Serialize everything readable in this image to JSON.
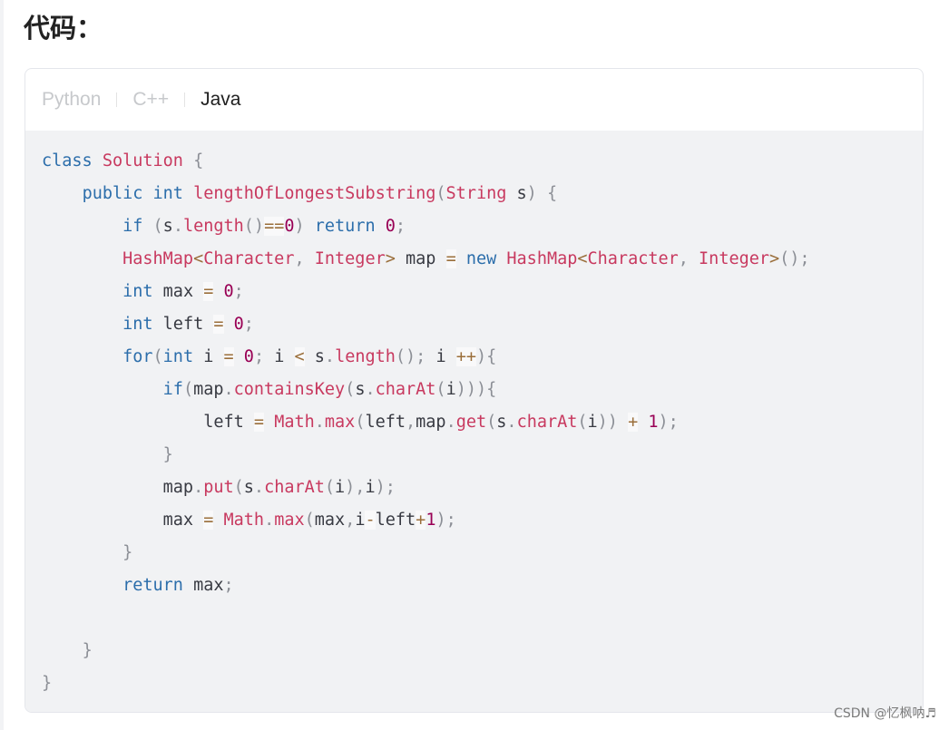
{
  "heading": "代码：",
  "tabs": [
    {
      "label": "Python",
      "active": false
    },
    {
      "label": "C++",
      "active": false
    },
    {
      "label": "Java",
      "active": true
    }
  ],
  "code_lines": [
    [
      [
        "kw",
        "class"
      ],
      [
        "id",
        " "
      ],
      [
        "ty",
        "Solution"
      ],
      [
        "id",
        " "
      ],
      [
        "pu",
        "{"
      ]
    ],
    [
      [
        "id",
        "    "
      ],
      [
        "kw",
        "public"
      ],
      [
        "id",
        " "
      ],
      [
        "kw",
        "int"
      ],
      [
        "id",
        " "
      ],
      [
        "fn",
        "lengthOfLongestSubstring"
      ],
      [
        "pu",
        "("
      ],
      [
        "ty",
        "String"
      ],
      [
        "id",
        " s"
      ],
      [
        "pu",
        ")"
      ],
      [
        "id",
        " "
      ],
      [
        "pu",
        "{"
      ]
    ],
    [
      [
        "id",
        "        "
      ],
      [
        "kw",
        "if"
      ],
      [
        "id",
        " "
      ],
      [
        "pu",
        "("
      ],
      [
        "id",
        "s"
      ],
      [
        "pu",
        "."
      ],
      [
        "fn",
        "length"
      ],
      [
        "pu",
        "()"
      ],
      [
        "op-hl",
        "=="
      ],
      [
        "num",
        "0"
      ],
      [
        "pu",
        ")"
      ],
      [
        "id",
        " "
      ],
      [
        "kw",
        "return"
      ],
      [
        "id",
        " "
      ],
      [
        "num",
        "0"
      ],
      [
        "pu",
        ";"
      ]
    ],
    [
      [
        "id",
        "        "
      ],
      [
        "ty",
        "HashMap"
      ],
      [
        "op",
        "<"
      ],
      [
        "ty",
        "Character"
      ],
      [
        "pu",
        ","
      ],
      [
        "id",
        " "
      ],
      [
        "ty",
        "Integer"
      ],
      [
        "op",
        ">"
      ],
      [
        "id",
        " map "
      ],
      [
        "op-hl",
        "="
      ],
      [
        "id",
        " "
      ],
      [
        "kw",
        "new"
      ],
      [
        "id",
        " "
      ],
      [
        "ty",
        "HashMap"
      ],
      [
        "op",
        "<"
      ],
      [
        "ty",
        "Character"
      ],
      [
        "pu",
        ","
      ],
      [
        "id",
        " "
      ],
      [
        "ty",
        "Integer"
      ],
      [
        "op",
        ">"
      ],
      [
        "pu",
        "();"
      ]
    ],
    [
      [
        "id",
        "        "
      ],
      [
        "kw",
        "int"
      ],
      [
        "id",
        " max "
      ],
      [
        "op-hl",
        "="
      ],
      [
        "id",
        " "
      ],
      [
        "num",
        "0"
      ],
      [
        "pu",
        ";"
      ]
    ],
    [
      [
        "id",
        "        "
      ],
      [
        "kw",
        "int"
      ],
      [
        "id",
        " left "
      ],
      [
        "op-hl",
        "="
      ],
      [
        "id",
        " "
      ],
      [
        "num",
        "0"
      ],
      [
        "pu",
        ";"
      ]
    ],
    [
      [
        "id",
        "        "
      ],
      [
        "kw",
        "for"
      ],
      [
        "pu",
        "("
      ],
      [
        "kw",
        "int"
      ],
      [
        "id",
        " i "
      ],
      [
        "op-hl",
        "="
      ],
      [
        "id",
        " "
      ],
      [
        "num",
        "0"
      ],
      [
        "pu",
        ";"
      ],
      [
        "id",
        " i "
      ],
      [
        "op-hl",
        "<"
      ],
      [
        "id",
        " s"
      ],
      [
        "pu",
        "."
      ],
      [
        "fn",
        "length"
      ],
      [
        "pu",
        "();"
      ],
      [
        "id",
        " i "
      ],
      [
        "op-hl",
        "++"
      ],
      [
        "pu",
        "){"
      ]
    ],
    [
      [
        "id",
        "            "
      ],
      [
        "kw",
        "if"
      ],
      [
        "pu",
        "("
      ],
      [
        "id",
        "map"
      ],
      [
        "pu",
        "."
      ],
      [
        "fn",
        "containsKey"
      ],
      [
        "pu",
        "("
      ],
      [
        "id",
        "s"
      ],
      [
        "pu",
        "."
      ],
      [
        "fn",
        "charAt"
      ],
      [
        "pu",
        "("
      ],
      [
        "id",
        "i"
      ],
      [
        "pu",
        "))){"
      ]
    ],
    [
      [
        "id",
        "                left "
      ],
      [
        "op-hl",
        "="
      ],
      [
        "id",
        " "
      ],
      [
        "ty",
        "Math"
      ],
      [
        "pu",
        "."
      ],
      [
        "fn",
        "max"
      ],
      [
        "pu",
        "("
      ],
      [
        "id",
        "left"
      ],
      [
        "pu",
        ","
      ],
      [
        "id",
        "map"
      ],
      [
        "pu",
        "."
      ],
      [
        "fn",
        "get"
      ],
      [
        "pu",
        "("
      ],
      [
        "id",
        "s"
      ],
      [
        "pu",
        "."
      ],
      [
        "fn",
        "charAt"
      ],
      [
        "pu",
        "("
      ],
      [
        "id",
        "i"
      ],
      [
        "pu",
        "))"
      ],
      [
        "id",
        " "
      ],
      [
        "op-hl",
        "+"
      ],
      [
        "id",
        " "
      ],
      [
        "num",
        "1"
      ],
      [
        "pu",
        ");"
      ]
    ],
    [
      [
        "id",
        "            "
      ],
      [
        "pu",
        "}"
      ]
    ],
    [
      [
        "id",
        "            map"
      ],
      [
        "pu",
        "."
      ],
      [
        "fn",
        "put"
      ],
      [
        "pu",
        "("
      ],
      [
        "id",
        "s"
      ],
      [
        "pu",
        "."
      ],
      [
        "fn",
        "charAt"
      ],
      [
        "pu",
        "("
      ],
      [
        "id",
        "i"
      ],
      [
        "pu",
        "),"
      ],
      [
        "id",
        "i"
      ],
      [
        "pu",
        ");"
      ]
    ],
    [
      [
        "id",
        "            max "
      ],
      [
        "op-hl",
        "="
      ],
      [
        "id",
        " "
      ],
      [
        "ty",
        "Math"
      ],
      [
        "pu",
        "."
      ],
      [
        "fn",
        "max"
      ],
      [
        "pu",
        "("
      ],
      [
        "id",
        "max"
      ],
      [
        "pu",
        ","
      ],
      [
        "id",
        "i"
      ],
      [
        "op-hl",
        "-"
      ],
      [
        "id",
        "left"
      ],
      [
        "op-hl",
        "+"
      ],
      [
        "num",
        "1"
      ],
      [
        "pu",
        ");"
      ]
    ],
    [
      [
        "id",
        "        "
      ],
      [
        "pu",
        "}"
      ]
    ],
    [
      [
        "id",
        "        "
      ],
      [
        "kw",
        "return"
      ],
      [
        "id",
        " max"
      ],
      [
        "pu",
        ";"
      ]
    ],
    [
      [
        "id",
        " "
      ]
    ],
    [
      [
        "id",
        "    "
      ],
      [
        "pu",
        "}"
      ]
    ],
    [
      [
        "pu",
        "}"
      ]
    ]
  ],
  "watermark": "CSDN @忆枫呐♬"
}
